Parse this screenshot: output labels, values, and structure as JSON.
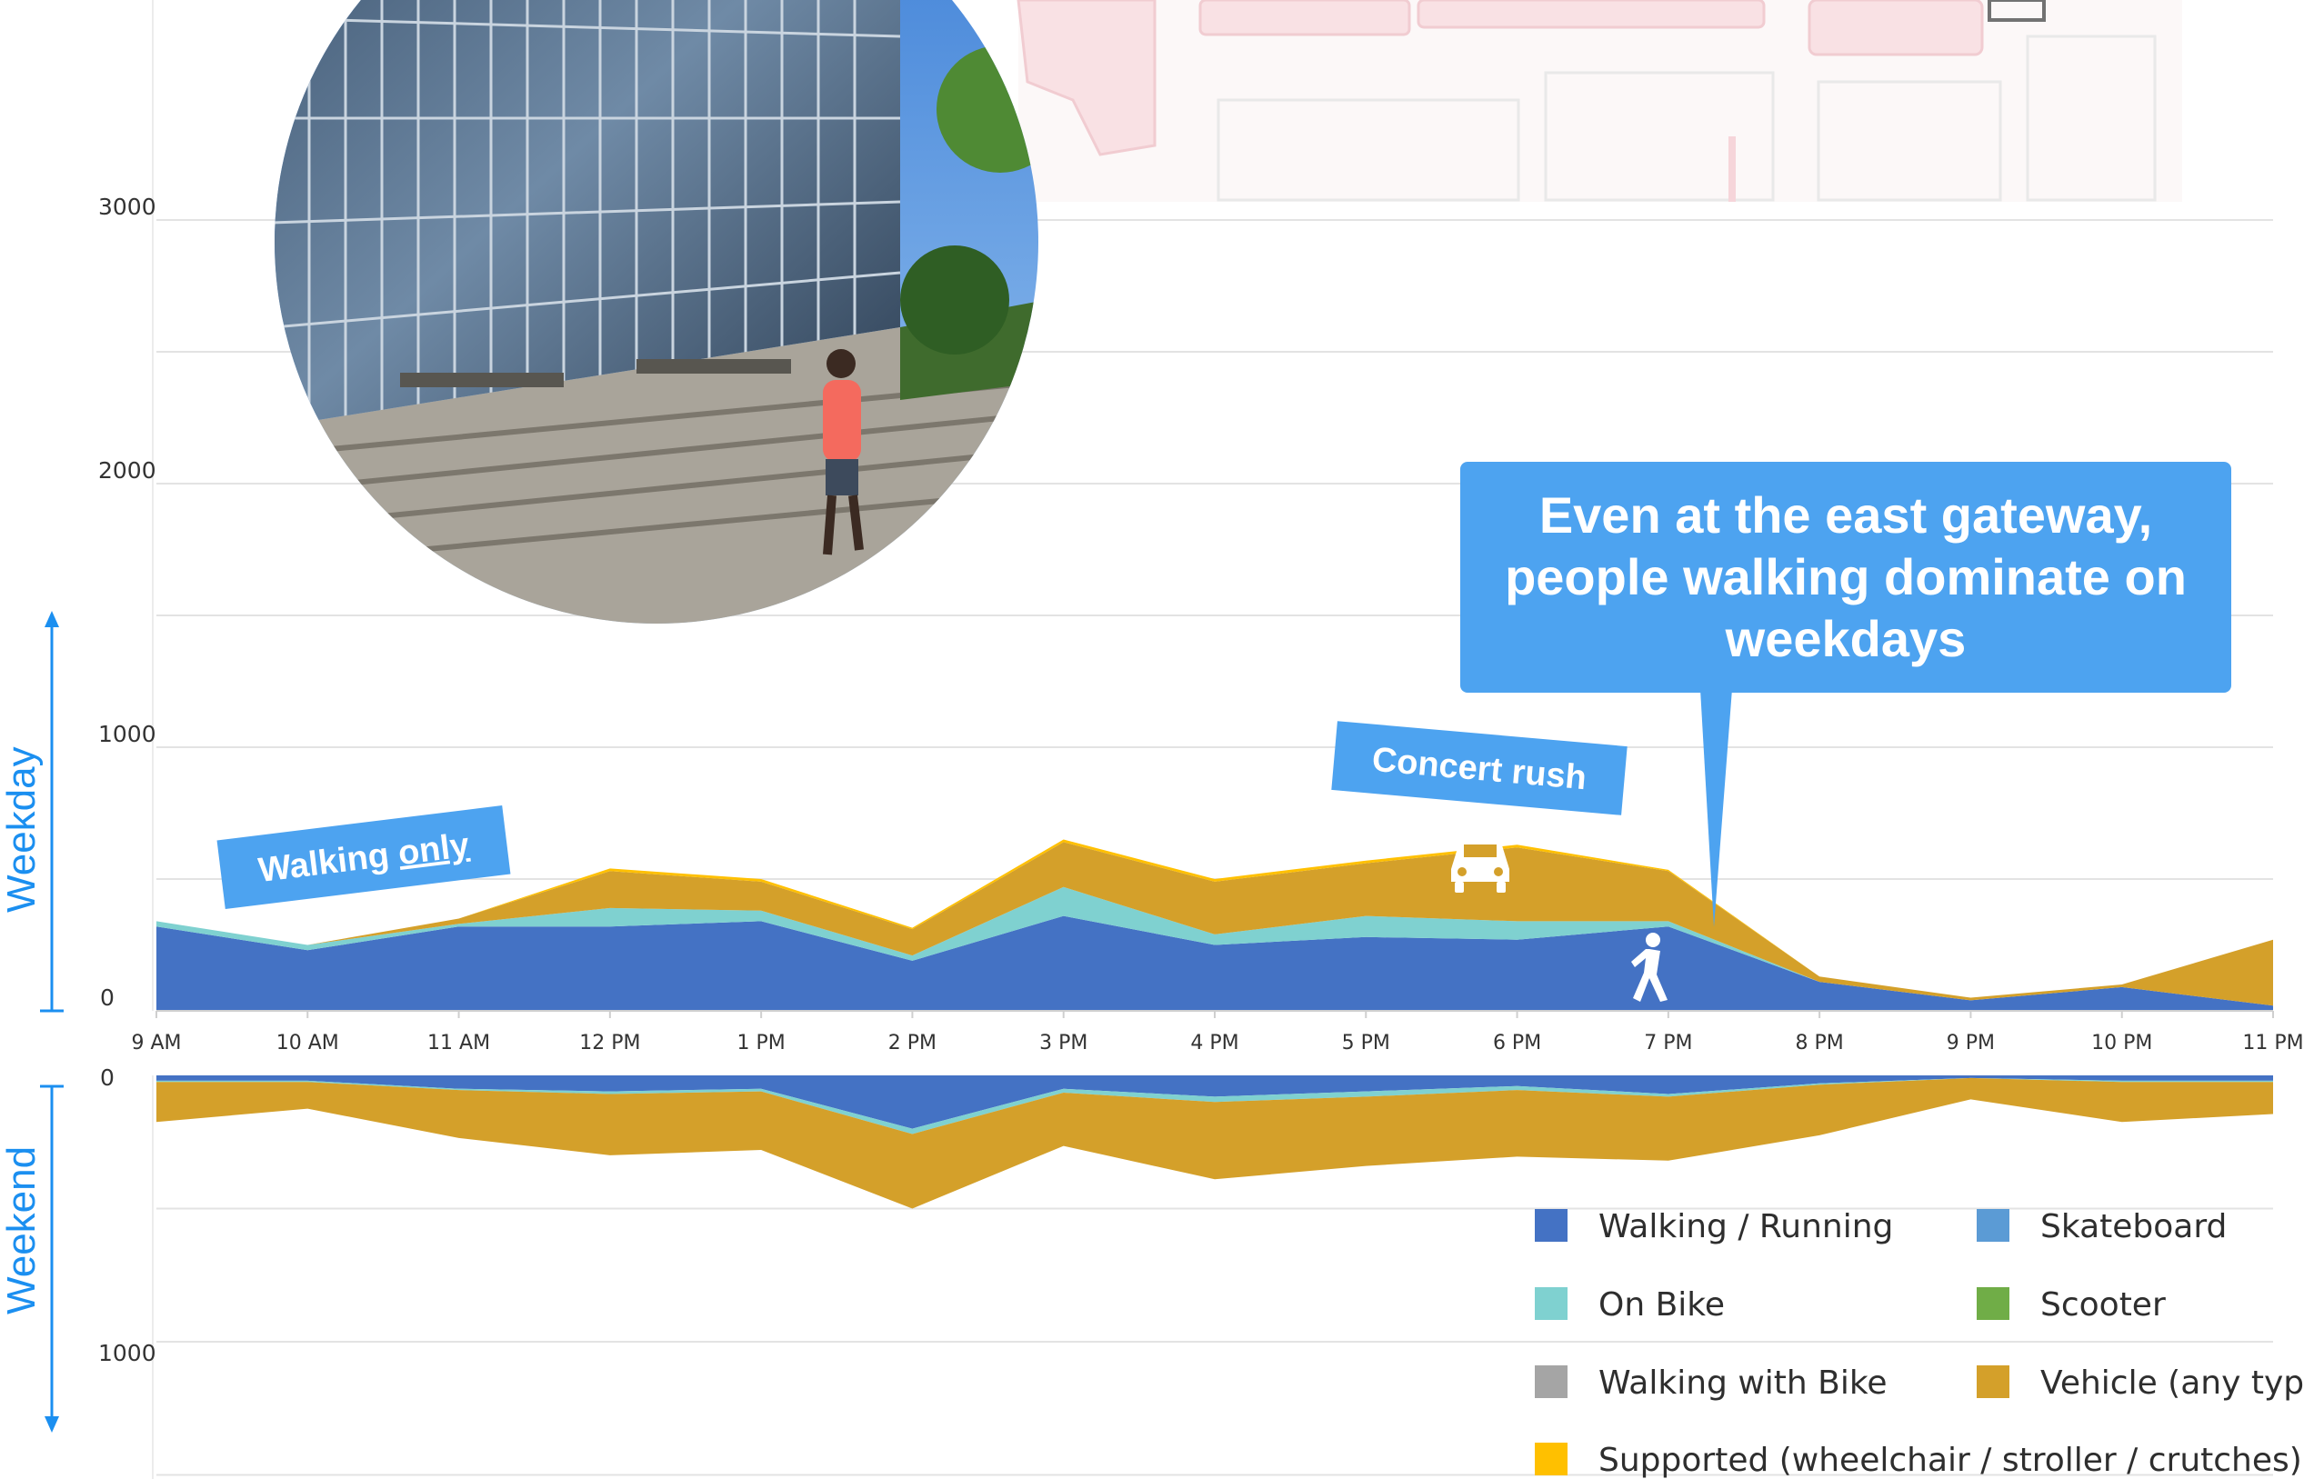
{
  "chart_data": [
    {
      "type": "area",
      "panel": "Weekday",
      "stacked": true,
      "categories": [
        "9 AM",
        "10 AM",
        "11 AM",
        "12 PM",
        "1 PM",
        "2 PM",
        "3 PM",
        "4 PM",
        "5 PM",
        "6 PM",
        "7 PM",
        "8 PM",
        "9 PM",
        "10 PM",
        "11 PM"
      ],
      "y_ticks": [
        "0",
        "1000",
        "2000",
        "3000"
      ],
      "ylim": [
        0,
        3000
      ],
      "series": [
        {
          "name": "Walking / Running",
          "color": "#4472c4",
          "values": [
            320,
            230,
            320,
            320,
            340,
            190,
            360,
            250,
            280,
            270,
            320,
            110,
            40,
            90,
            20
          ]
        },
        {
          "name": "Skateboard",
          "color": "#5b9bd5",
          "values": [
            0,
            0,
            0,
            0,
            0,
            0,
            0,
            0,
            0,
            0,
            0,
            0,
            0,
            0,
            0
          ]
        },
        {
          "name": "On Bike",
          "color": "#7fd1d0",
          "values": [
            20,
            20,
            10,
            70,
            40,
            20,
            110,
            40,
            80,
            70,
            20,
            0,
            0,
            0,
            0
          ]
        },
        {
          "name": "Scooter",
          "color": "#70ad47",
          "values": [
            0,
            0,
            0,
            0,
            0,
            0,
            0,
            0,
            0,
            0,
            0,
            0,
            0,
            0,
            0
          ]
        },
        {
          "name": "Walking with Bike",
          "color": "#a5a5a5",
          "values": [
            0,
            0,
            0,
            0,
            0,
            0,
            0,
            0,
            0,
            0,
            0,
            0,
            0,
            0,
            0
          ]
        },
        {
          "name": "Vehicle (any type)",
          "color": "#d4a02a",
          "values": [
            0,
            0,
            20,
            140,
            110,
            100,
            170,
            200,
            200,
            280,
            190,
            20,
            10,
            10,
            250
          ]
        },
        {
          "name": "Supported (wheelchair / stroller / crutches)",
          "color": "#ffc000",
          "values": [
            0,
            0,
            0,
            10,
            10,
            5,
            10,
            10,
            10,
            10,
            5,
            0,
            0,
            0,
            0
          ]
        }
      ]
    },
    {
      "type": "area",
      "panel": "Weekend",
      "stacked": true,
      "inverted": true,
      "categories": [
        "9 AM",
        "10 AM",
        "11 AM",
        "12 PM",
        "1 PM",
        "2 PM",
        "3 PM",
        "4 PM",
        "5 PM",
        "6 PM",
        "7 PM",
        "8 PM",
        "9 PM",
        "10 PM",
        "11 PM"
      ],
      "y_ticks": [
        "0",
        "1000"
      ],
      "ylim": [
        0,
        1500
      ],
      "series": [
        {
          "name": "Walking / Running",
          "color": "#4472c4",
          "values": [
            20,
            20,
            50,
            60,
            50,
            200,
            50,
            80,
            60,
            40,
            70,
            30,
            10,
            20,
            20
          ]
        },
        {
          "name": "Skateboard",
          "color": "#5b9bd5",
          "values": [
            0,
            0,
            0,
            0,
            0,
            0,
            0,
            0,
            0,
            0,
            0,
            0,
            0,
            0,
            0
          ]
        },
        {
          "name": "On Bike",
          "color": "#7fd1d0",
          "values": [
            5,
            5,
            5,
            10,
            10,
            20,
            15,
            20,
            20,
            15,
            10,
            5,
            0,
            5,
            5
          ]
        },
        {
          "name": "Scooter",
          "color": "#70ad47",
          "values": [
            0,
            0,
            0,
            0,
            0,
            0,
            0,
            0,
            0,
            0,
            0,
            0,
            0,
            0,
            0
          ]
        },
        {
          "name": "Walking with Bike",
          "color": "#a5a5a5",
          "values": [
            0,
            0,
            0,
            0,
            0,
            0,
            0,
            0,
            0,
            0,
            0,
            0,
            0,
            0,
            0
          ]
        },
        {
          "name": "Vehicle (any type)",
          "color": "#d4a02a",
          "values": [
            150,
            100,
            180,
            230,
            220,
            280,
            200,
            290,
            260,
            250,
            240,
            190,
            80,
            150,
            120
          ]
        },
        {
          "name": "Supported (wheelchair / stroller / crutches)",
          "color": "#ffc000",
          "values": [
            0,
            0,
            0,
            0,
            0,
            0,
            0,
            0,
            0,
            0,
            0,
            0,
            0,
            0,
            0
          ]
        }
      ]
    }
  ],
  "labels": {
    "weekday": "Weekday",
    "weekend": "Weekend",
    "callout": "Even at the east gateway, people walking dominate on weekdays",
    "concert_tag": "Concert rush",
    "walking_tag_prefix": "Walking ",
    "walking_tag_emphasis": "only"
  },
  "icons": {
    "vehicle": "car-icon",
    "walking": "pedestrian-icon",
    "photo": "building-photo",
    "map": "campus-map"
  },
  "colors": {
    "accent": "#1b8ff0",
    "callout": "#4da3f0",
    "grid": "#e3e3e3"
  }
}
